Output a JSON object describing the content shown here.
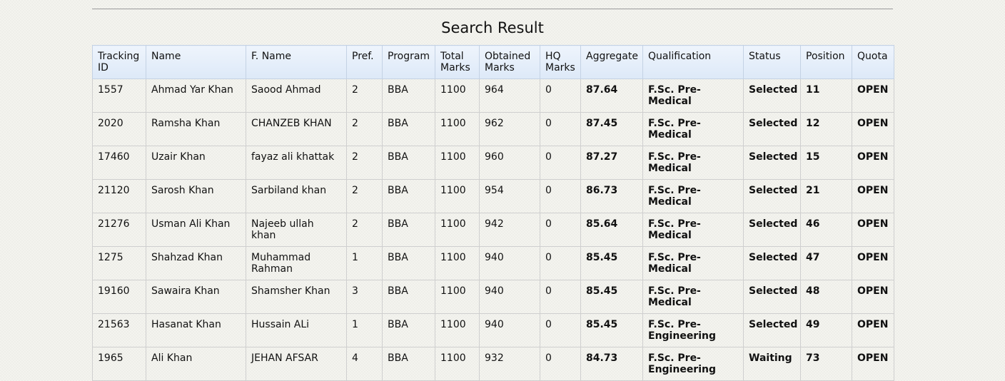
{
  "title": "Search Result",
  "columns": [
    "Tracking ID",
    "Name",
    "F. Name",
    "Pref.",
    "Program",
    "Total Marks",
    "Obtained Marks",
    "HQ Marks",
    "Aggregate",
    "Qualification",
    "Status",
    "Position",
    "Quota"
  ],
  "rows": [
    {
      "tracking_id": "1557",
      "name": "Ahmad Yar Khan",
      "father_name": "Saood Ahmad",
      "pref": "2",
      "program": "BBA",
      "total_marks": "1100",
      "obtained_marks": "964",
      "hq_marks": "0",
      "aggregate": "87.64",
      "qualification": "F.Sc. Pre-Medical",
      "status": "Selected",
      "position": "11",
      "quota": "OPEN"
    },
    {
      "tracking_id": "2020",
      "name": "Ramsha Khan",
      "father_name": "CHANZEB KHAN",
      "pref": "2",
      "program": "BBA",
      "total_marks": "1100",
      "obtained_marks": "962",
      "hq_marks": "0",
      "aggregate": "87.45",
      "qualification": "F.Sc. Pre-Medical",
      "status": "Selected",
      "position": "12",
      "quota": "OPEN"
    },
    {
      "tracking_id": "17460",
      "name": "Uzair Khan",
      "father_name": "fayaz ali khattak",
      "pref": "2",
      "program": "BBA",
      "total_marks": "1100",
      "obtained_marks": "960",
      "hq_marks": "0",
      "aggregate": "87.27",
      "qualification": "F.Sc. Pre-Medical",
      "status": "Selected",
      "position": "15",
      "quota": "OPEN"
    },
    {
      "tracking_id": "21120",
      "name": "Sarosh Khan",
      "father_name": "Sarbiland khan",
      "pref": "2",
      "program": "BBA",
      "total_marks": "1100",
      "obtained_marks": "954",
      "hq_marks": "0",
      "aggregate": "86.73",
      "qualification": "F.Sc. Pre-Medical",
      "status": "Selected",
      "position": "21",
      "quota": "OPEN"
    },
    {
      "tracking_id": "21276",
      "name": "Usman Ali Khan",
      "father_name": "Najeeb ullah khan",
      "pref": "2",
      "program": "BBA",
      "total_marks": "1100",
      "obtained_marks": "942",
      "hq_marks": "0",
      "aggregate": "85.64",
      "qualification": "F.Sc. Pre-Medical",
      "status": "Selected",
      "position": "46",
      "quota": "OPEN"
    },
    {
      "tracking_id": "1275",
      "name": "Shahzad Khan",
      "father_name": "Muhammad Rahman",
      "pref": "1",
      "program": "BBA",
      "total_marks": "1100",
      "obtained_marks": "940",
      "hq_marks": "0",
      "aggregate": "85.45",
      "qualification": "F.Sc. Pre-Medical",
      "status": "Selected",
      "position": "47",
      "quota": "OPEN"
    },
    {
      "tracking_id": "19160",
      "name": "Sawaira Khan",
      "father_name": "Shamsher Khan",
      "pref": "3",
      "program": "BBA",
      "total_marks": "1100",
      "obtained_marks": "940",
      "hq_marks": "0",
      "aggregate": "85.45",
      "qualification": "F.Sc. Pre-Medical",
      "status": "Selected",
      "position": "48",
      "quota": "OPEN"
    },
    {
      "tracking_id": "21563",
      "name": "Hasanat Khan",
      "father_name": "Hussain ALi",
      "pref": "1",
      "program": "BBA",
      "total_marks": "1100",
      "obtained_marks": "940",
      "hq_marks": "0",
      "aggregate": "85.45",
      "qualification": "F.Sc. Pre-Engineering",
      "status": "Selected",
      "position": "49",
      "quota": "OPEN"
    },
    {
      "tracking_id": "1965",
      "name": "Ali Khan",
      "father_name": "JEHAN AFSAR",
      "pref": "4",
      "program": "BBA",
      "total_marks": "1100",
      "obtained_marks": "932",
      "hq_marks": "0",
      "aggregate": "84.73",
      "qualification": "F.Sc. Pre-Engineering",
      "status": "Waiting",
      "position": "73",
      "quota": "OPEN"
    }
  ]
}
